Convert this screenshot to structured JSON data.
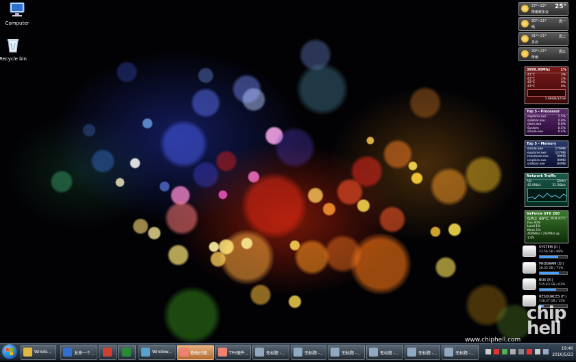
{
  "desktop_icons": [
    {
      "label": "Computer",
      "icon": "computer-icon"
    },
    {
      "label": "Recycle bin",
      "icon": "recycle-bin-icon"
    }
  ],
  "weather": [
    {
      "temp": "27°~22°",
      "cond": "阵雨转多云",
      "day": "",
      "now": "25°"
    },
    {
      "temp": "30°~21°",
      "cond": "晴",
      "day": "周一",
      "now": ""
    },
    {
      "temp": "31°~21°",
      "cond": "多云",
      "day": "周二",
      "now": ""
    },
    {
      "temp": "29°~21°",
      "cond": "阵雨",
      "day": "周三",
      "now": ""
    }
  ],
  "cpu_meter": {
    "freq": "3999.95Mhz",
    "load": "1%",
    "temps": [
      "41°C",
      "42°C",
      "42°C",
      "41°C"
    ],
    "core_loads": [
      "3%",
      "2%",
      "0%",
      "0%"
    ],
    "ram": "1.66GB/12GB"
  },
  "top_processor": {
    "title": "Top 5 - Processor",
    "rows": [
      [
        "explorer.exe",
        "1.5%"
      ],
      [
        "sidebar.exe",
        "0.8%"
      ],
      [
        "dwm.exe",
        "0.8%"
      ],
      [
        "System",
        "0.5%"
      ],
      [
        "smule.exe",
        "0.4%"
      ]
    ]
  },
  "top_memory": {
    "title": "Top 5 - Memory",
    "rows": [
      [
        "smule.exe",
        "176MB"
      ],
      [
        "explorer.exe",
        "127MB"
      ],
      [
        "maxmem.exe",
        "99MB"
      ],
      [
        "iexplore.exe",
        "90MB"
      ],
      [
        "sidebar.exe",
        "84MB"
      ]
    ]
  },
  "network": {
    "title": "Network Traffic",
    "up_label": "Up",
    "down_label": "Down",
    "up": "45.0Kb/s",
    "down": "31.5Kb/s"
  },
  "gpu": {
    "title": "GeForce GTX 260",
    "gpu_temp": "GPU: 49°C",
    "pcb_temp": "PCB 41°C",
    "rows": [
      "Fan 40%",
      "Load 1%",
      "Mem 1%"
    ],
    "clocks": "400MHz / 297MHz @ 1.0V"
  },
  "disks": [
    {
      "name": "SYSTEM (C:)",
      "info": "23.56 GB / 68%",
      "fill": 0.68
    },
    {
      "name": "PROGRAM (D:)",
      "info": "28.35 GB / 71%",
      "fill": 0.71
    },
    {
      "name": "BOX (E:)",
      "info": "535.43 GB / 61%",
      "fill": 0.61
    },
    {
      "name": "RESOURCES (F:)",
      "info": "138.37 GB / 15%",
      "fill": 0.15
    }
  ],
  "watermark": "www.chiphell.com",
  "logo_text": "chip hell",
  "taskbar": {
    "items": [
      {
        "label": "Windo...",
        "icon": "folder-icon",
        "color": "#e0b840",
        "active": false
      },
      {
        "label": "发来一个...",
        "icon": "ie-icon",
        "color": "#3070d0",
        "active": false
      },
      {
        "label": "",
        "icon": "chrome-icon",
        "color": "#d04030",
        "active": false
      },
      {
        "label": "",
        "icon": "excel-icon",
        "color": "#2a8a3a",
        "active": false
      },
      {
        "label": "Window...",
        "icon": "network-icon",
        "color": "#5aa0d0",
        "active": false
      },
      {
        "label": "勤勉扫描...",
        "icon": "flower-icon",
        "color": "#f08070",
        "active": true
      },
      {
        "label": "TPY硬件...",
        "icon": "flower-icon",
        "color": "#f08070",
        "active": false
      },
      {
        "label": "无标题 -...",
        "icon": "paint-icon",
        "color": "#90a8c0",
        "active": false
      },
      {
        "label": "无标题 -...",
        "icon": "paint-icon",
        "color": "#90a8c0",
        "active": false
      },
      {
        "label": "无标题 -...",
        "icon": "paint-icon",
        "color": "#90a8c0",
        "active": false
      },
      {
        "label": "无标题 -...",
        "icon": "paint-icon",
        "color": "#90a8c0",
        "active": false
      },
      {
        "label": "无标题 -...",
        "icon": "paint-icon",
        "color": "#90a8c0",
        "active": false
      },
      {
        "label": "无标题 -...",
        "icon": "paint-icon",
        "color": "#90a8c0",
        "active": false
      },
      {
        "label": "无标题 -...",
        "icon": "paint-icon",
        "color": "#90a8c0",
        "active": false
      }
    ],
    "clock_time": "19:40",
    "clock_date": "2010/5/23"
  }
}
